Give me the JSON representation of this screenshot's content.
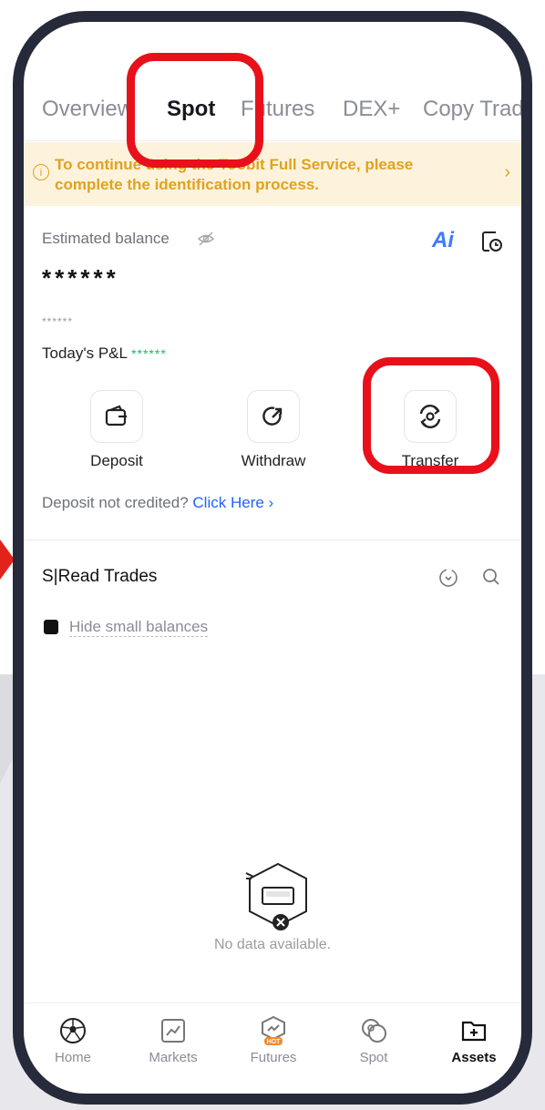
{
  "tabs": [
    "Overview",
    "Spot",
    "Futures",
    "DEX+",
    "Copy Trad"
  ],
  "active_tab": "Spot",
  "banner": {
    "text": "To continue using the Toobit Full Service, please complete the identification process.",
    "icon": "info-icon",
    "chevron": "›"
  },
  "balance": {
    "label": "Estimated balance",
    "value": "******",
    "sub_value": "******",
    "pnl_label": "Today's P&L",
    "pnl_value": "******",
    "ai_label": "Ai"
  },
  "actions": [
    {
      "label": "Deposit",
      "icon": "wallet-icon"
    },
    {
      "label": "Withdraw",
      "icon": "arrow-out-icon"
    },
    {
      "label": "Transfer",
      "icon": "transfer-icon"
    }
  ],
  "deposit_note": {
    "text": "Deposit not credited?",
    "link": "Click Here",
    "chevron": "›"
  },
  "section": {
    "title": "S|Read Trades",
    "hide_small": "Hide small balances"
  },
  "empty": {
    "text": "No data available."
  },
  "nav": [
    {
      "label": "Home",
      "icon": "home-ball-icon"
    },
    {
      "label": "Markets",
      "icon": "chart-icon"
    },
    {
      "label": "Futures",
      "icon": "futures-icon",
      "badge": "HOT"
    },
    {
      "label": "Spot",
      "icon": "coins-icon"
    },
    {
      "label": "Assets",
      "icon": "folder-icon",
      "active": true
    }
  ],
  "colors": {
    "accent_blue": "#1f63ff",
    "warning": "#e1a21f",
    "positive": "#1cb86a",
    "highlight_red": "#e8101a",
    "phone_frame": "#262a3a"
  }
}
